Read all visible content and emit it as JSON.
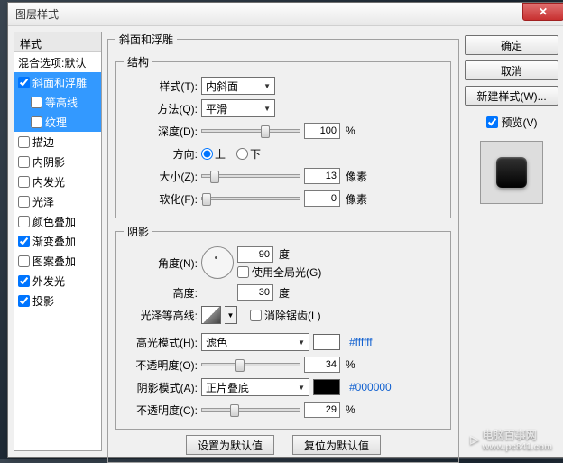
{
  "dialog": {
    "title": "图层样式"
  },
  "left": {
    "header": "样式",
    "items": [
      {
        "label": "混合选项:默认",
        "checked": null,
        "selected": false,
        "sub": false
      },
      {
        "label": "斜面和浮雕",
        "checked": true,
        "selected": true,
        "sub": false
      },
      {
        "label": "等高线",
        "checked": false,
        "selected": true,
        "sub": true
      },
      {
        "label": "纹理",
        "checked": false,
        "selected": true,
        "sub": true
      },
      {
        "label": "描边",
        "checked": false,
        "selected": false,
        "sub": false
      },
      {
        "label": "内阴影",
        "checked": false,
        "selected": false,
        "sub": false
      },
      {
        "label": "内发光",
        "checked": false,
        "selected": false,
        "sub": false
      },
      {
        "label": "光泽",
        "checked": false,
        "selected": false,
        "sub": false
      },
      {
        "label": "颜色叠加",
        "checked": false,
        "selected": false,
        "sub": false
      },
      {
        "label": "渐变叠加",
        "checked": true,
        "selected": false,
        "sub": false
      },
      {
        "label": "图案叠加",
        "checked": false,
        "selected": false,
        "sub": false
      },
      {
        "label": "外发光",
        "checked": true,
        "selected": false,
        "sub": false
      },
      {
        "label": "投影",
        "checked": true,
        "selected": false,
        "sub": false
      }
    ]
  },
  "mid": {
    "group_title": "斜面和浮雕",
    "structure": {
      "title": "结构",
      "style_label": "样式(T):",
      "style_value": "内斜面",
      "method_label": "方法(Q):",
      "method_value": "平滑",
      "depth_label": "深度(D):",
      "depth_value": "100",
      "depth_unit": "%",
      "depth_pct": 60,
      "direction_label": "方向:",
      "up": "上",
      "down": "下",
      "size_label": "大小(Z):",
      "size_value": "13",
      "size_unit": "像素",
      "size_pct": 8,
      "soften_label": "软化(F):",
      "soften_value": "0",
      "soften_unit": "像素",
      "soften_pct": 0
    },
    "shading": {
      "title": "阴影",
      "angle_label": "角度(N):",
      "angle_value": "90",
      "angle_unit": "度",
      "global_label": "使用全局光(G)",
      "altitude_label": "高度:",
      "altitude_value": "30",
      "altitude_unit": "度",
      "gloss_label": "光泽等高线:",
      "aa_label": "消除锯齿(L)",
      "hl_mode_label": "高光模式(H):",
      "hl_mode_value": "滤色",
      "hl_color": "#ffffff",
      "hl_hex": "#ffffff",
      "hl_op_label": "不透明度(O):",
      "hl_op_value": "34",
      "hl_op_unit": "%",
      "hl_op_pct": 34,
      "sh_mode_label": "阴影模式(A):",
      "sh_mode_value": "正片叠底",
      "sh_color": "#000000",
      "sh_hex": "#000000",
      "sh_op_label": "不透明度(C):",
      "sh_op_value": "29",
      "sh_op_unit": "%",
      "sh_op_pct": 29
    },
    "buttons": {
      "set_default": "设置为默认值",
      "reset_default": "复位为默认值"
    }
  },
  "right": {
    "ok": "确定",
    "cancel": "取消",
    "new_style": "新建样式(W)...",
    "preview_label": "预览(V)"
  },
  "watermark": {
    "brand": "电脑百事网",
    "url": "www.pc841.com"
  }
}
